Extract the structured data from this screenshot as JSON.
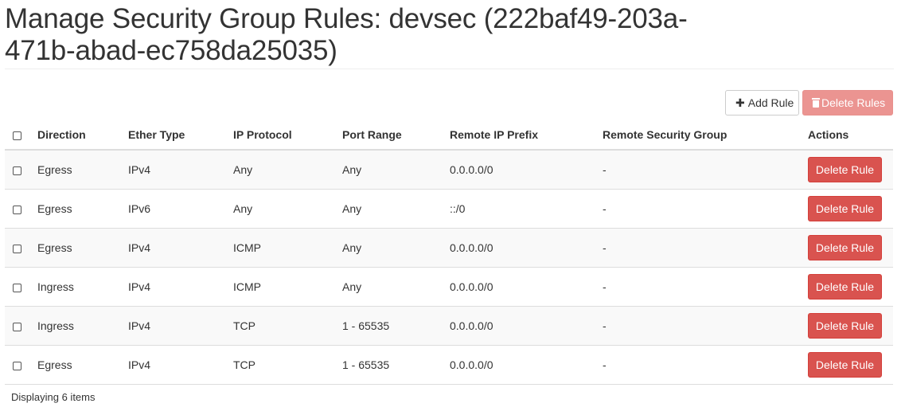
{
  "page": {
    "title": "Manage Security Group Rules: devsec (222baf49-203a-471b-abad-ec758da25035)"
  },
  "toolbar": {
    "add_label": "Add Rule",
    "delete_label": "Delete Rules",
    "add_icon": "plus-icon",
    "delete_icon": "trash-icon"
  },
  "table": {
    "headers": {
      "direction": "Direction",
      "ether_type": "Ether Type",
      "ip_protocol": "IP Protocol",
      "port_range": "Port Range",
      "remote_ip_prefix": "Remote IP Prefix",
      "remote_security_group": "Remote Security Group",
      "actions": "Actions"
    },
    "rows": [
      {
        "direction": "Egress",
        "ether_type": "IPv4",
        "ip_protocol": "Any",
        "port_range": "Any",
        "remote_ip_prefix": "0.0.0.0/0",
        "remote_security_group": "-",
        "action_label": "Delete Rule"
      },
      {
        "direction": "Egress",
        "ether_type": "IPv6",
        "ip_protocol": "Any",
        "port_range": "Any",
        "remote_ip_prefix": "::/0",
        "remote_security_group": "-",
        "action_label": "Delete Rule"
      },
      {
        "direction": "Egress",
        "ether_type": "IPv4",
        "ip_protocol": "ICMP",
        "port_range": "Any",
        "remote_ip_prefix": "0.0.0.0/0",
        "remote_security_group": "-",
        "action_label": "Delete Rule"
      },
      {
        "direction": "Ingress",
        "ether_type": "IPv4",
        "ip_protocol": "ICMP",
        "port_range": "Any",
        "remote_ip_prefix": "0.0.0.0/0",
        "remote_security_group": "-",
        "action_label": "Delete Rule"
      },
      {
        "direction": "Ingress",
        "ether_type": "IPv4",
        "ip_protocol": "TCP",
        "port_range": "1 - 65535",
        "remote_ip_prefix": "0.0.0.0/0",
        "remote_security_group": "-",
        "action_label": "Delete Rule"
      },
      {
        "direction": "Egress",
        "ether_type": "IPv4",
        "ip_protocol": "TCP",
        "port_range": "1 - 65535",
        "remote_ip_prefix": "0.0.0.0/0",
        "remote_security_group": "-",
        "action_label": "Delete Rule"
      }
    ]
  },
  "footer": {
    "count_text": "Displaying 6 items"
  },
  "colors": {
    "danger": "#d9534f",
    "danger_disabled": "#eb9491",
    "row_stripe": "#f9f9f9"
  }
}
